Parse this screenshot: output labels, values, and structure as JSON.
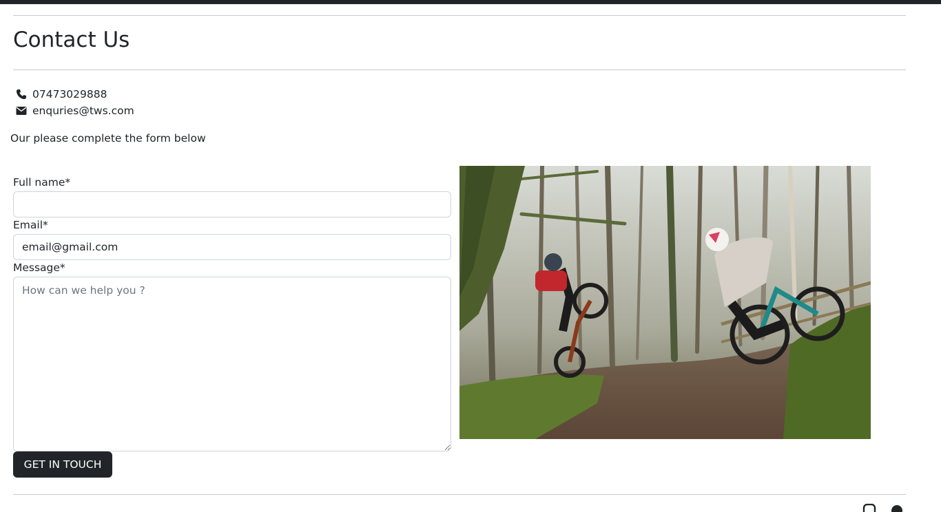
{
  "page": {
    "title": "Contact Us"
  },
  "contact": {
    "phone": "07473029888",
    "email": "enquries@tws.com",
    "phone_icon": "phone-icon",
    "email_icon": "envelope-icon"
  },
  "intro_text": "Our please complete the form below",
  "form": {
    "full_name_label": "Full name*",
    "full_name_value": "",
    "email_label": "Email*",
    "email_value": "email@gmail.com",
    "message_label": "Message*",
    "message_placeholder": "How can we help you ?",
    "submit_label": "GET IN TOUCH"
  },
  "image": {
    "subject": "two mountain bikers riding a muddy forest trail"
  },
  "footer": {
    "icons": [
      "instagram-icon",
      "facebook-icon"
    ]
  },
  "colors": {
    "dark": "#212529",
    "rule": "#c8c8c8",
    "field_border": "#ced4da"
  }
}
